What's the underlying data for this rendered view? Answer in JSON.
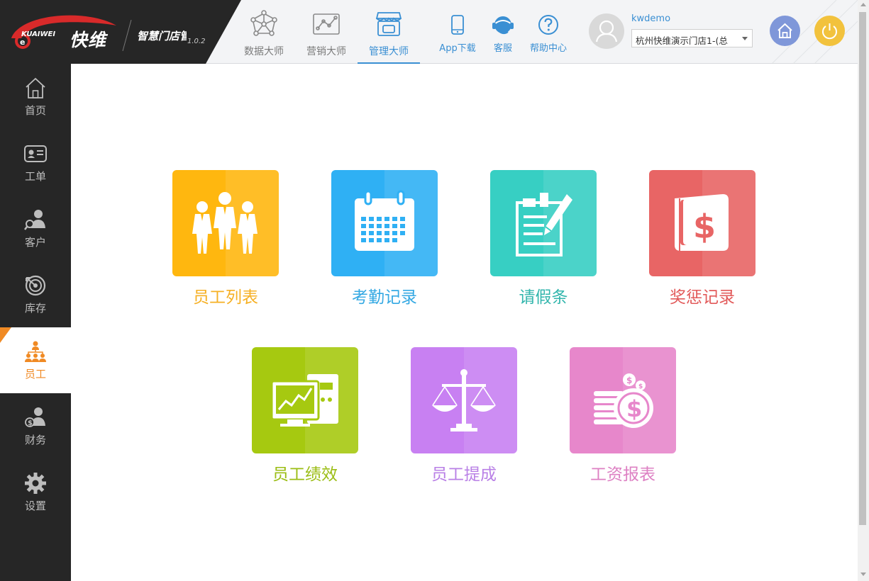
{
  "brand": {
    "logo_en": "KUAIWEI",
    "logo_cn": "快维",
    "product_name": "智慧门店管理",
    "version": "1.0.2"
  },
  "topnav": [
    {
      "label": "数据大师",
      "icon": "network-icon",
      "active": false
    },
    {
      "label": "营销大师",
      "icon": "trend-chart-icon",
      "active": false
    },
    {
      "label": "管理大师",
      "icon": "store-icon",
      "active": true
    }
  ],
  "utils": [
    {
      "label": "App下载",
      "icon": "phone-icon"
    },
    {
      "label": "客服",
      "icon": "headset-icon"
    },
    {
      "label": "帮助中心",
      "icon": "help-icon"
    }
  ],
  "user": {
    "username": "kwdemo",
    "store_selected": "杭州快维演示门店1-(总"
  },
  "sidebar": [
    {
      "label": "首页",
      "icon": "home-icon",
      "active": false
    },
    {
      "label": "工单",
      "icon": "work-order-icon",
      "active": false
    },
    {
      "label": "客户",
      "icon": "customer-icon",
      "active": false
    },
    {
      "label": "库存",
      "icon": "inventory-icon",
      "active": false
    },
    {
      "label": "员工",
      "icon": "staff-icon",
      "active": true
    },
    {
      "label": "财务",
      "icon": "finance-icon",
      "active": false
    },
    {
      "label": "设置",
      "icon": "settings-icon",
      "active": false
    }
  ],
  "tiles": [
    {
      "label": "员工列表",
      "icon": "staff-group-icon",
      "color": "#ffb70f",
      "text_color": "#f6b024"
    },
    {
      "label": "考勤记录",
      "icon": "calendar-icon",
      "color": "#2fb0f4",
      "text_color": "#35a9e3"
    },
    {
      "label": "请假条",
      "icon": "leave-note-icon",
      "color": "#37cfc3",
      "text_color": "#33b6ad"
    },
    {
      "label": "奖惩记录",
      "icon": "reward-book-icon",
      "color": "#e86565",
      "text_color": "#e25a5a"
    },
    {
      "label": "员工绩效",
      "icon": "performance-monitor-icon",
      "color": "#a6c910",
      "text_color": "#9bbd14"
    },
    {
      "label": "员工提成",
      "icon": "balance-scale-icon",
      "color": "#c880f2",
      "text_color": "#b980e6"
    },
    {
      "label": "工资报表",
      "icon": "coins-icon",
      "color": "#e787cb",
      "text_color": "#dd80c3"
    }
  ]
}
